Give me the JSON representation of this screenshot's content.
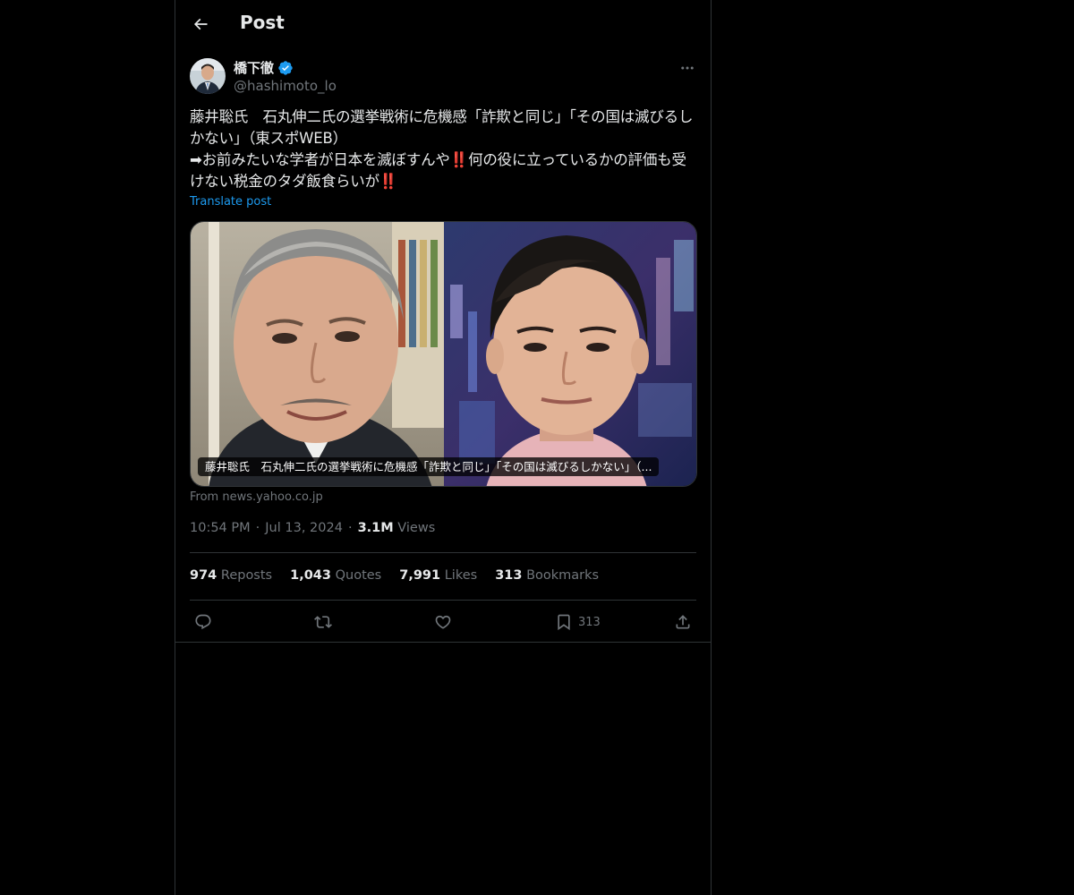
{
  "header": {
    "title": "Post",
    "back_icon": "arrow-left-icon"
  },
  "author": {
    "display_name": "橋下徹",
    "handle": "@hashimoto_lo",
    "verified": true,
    "verified_color": "#1d9bf0"
  },
  "tweet": {
    "text": "藤井聡氏　石丸伸二氏の選挙戦術に危機感「詐欺と同じ」「その国は滅びるしかない」（東スポWEB）\n➡お前みたいな学者が日本を滅ぼすんや‼️何の役に立っているかの評価も受けない税金のタダ飯食らいが‼️",
    "translate_label": "Translate post"
  },
  "card": {
    "caption": "藤井聡氏　石丸伸二氏の選挙戦術に危機感「詐欺と同じ」「その国は滅びるしかない」（...",
    "source": "From news.yahoo.co.jp"
  },
  "meta": {
    "time": "10:54 PM",
    "date": "Jul 13, 2024",
    "views_count": "3.1M",
    "views_label": "Views"
  },
  "stats": {
    "reposts_count": "974",
    "reposts_label": "Reposts",
    "quotes_count": "1,043",
    "quotes_label": "Quotes",
    "likes_count": "7,991",
    "likes_label": "Likes",
    "bookmarks_count": "313",
    "bookmarks_label": "Bookmarks"
  },
  "actions": {
    "bookmark_count": "313"
  },
  "colors": {
    "background": "#000000",
    "text": "#e7e9ea",
    "secondary": "#71767b",
    "accent": "#1d9bf0",
    "border": "#2f3336"
  }
}
